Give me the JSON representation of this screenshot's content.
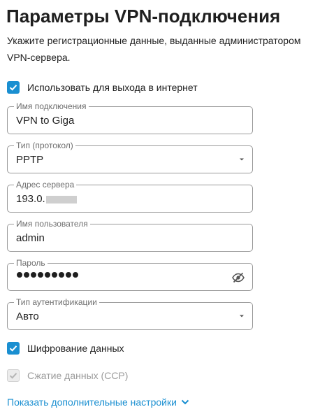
{
  "page": {
    "title": "Параметры VPN-подключения",
    "description": "Укажите регистрационные данные, выданные администратором VPN-сервера."
  },
  "options": {
    "use_for_internet": {
      "label": "Использовать для выхода в интернет",
      "checked": true
    },
    "data_encryption": {
      "label": "Шифрование данных",
      "checked": true
    },
    "data_compression": {
      "label": "Сжатие данных (CCP)",
      "checked": true,
      "disabled": true
    }
  },
  "fields": {
    "connection_name": {
      "label": "Имя подключения",
      "value": "VPN to Giga"
    },
    "protocol": {
      "label": "Тип (протокол)",
      "value": "PPTP"
    },
    "server_address": {
      "label": "Адрес сервера",
      "value": "193.0."
    },
    "username": {
      "label": "Имя пользователя",
      "value": "admin"
    },
    "password": {
      "label": "Пароль",
      "masked_length": 9
    },
    "auth_type": {
      "label": "Тип аутентификации",
      "value": "Авто"
    }
  },
  "links": {
    "show_more": "Показать дополнительные настройки"
  },
  "colors": {
    "accent": "#1a8fd1",
    "border": "#9a9a9a",
    "label": "#6e6e6e",
    "disabled_text": "#9b9b9b"
  },
  "icons": {
    "checkbox": "check-icon",
    "select": "caret-down-icon",
    "password_toggle": "eye-off-icon",
    "link": "chevron-down-icon"
  }
}
